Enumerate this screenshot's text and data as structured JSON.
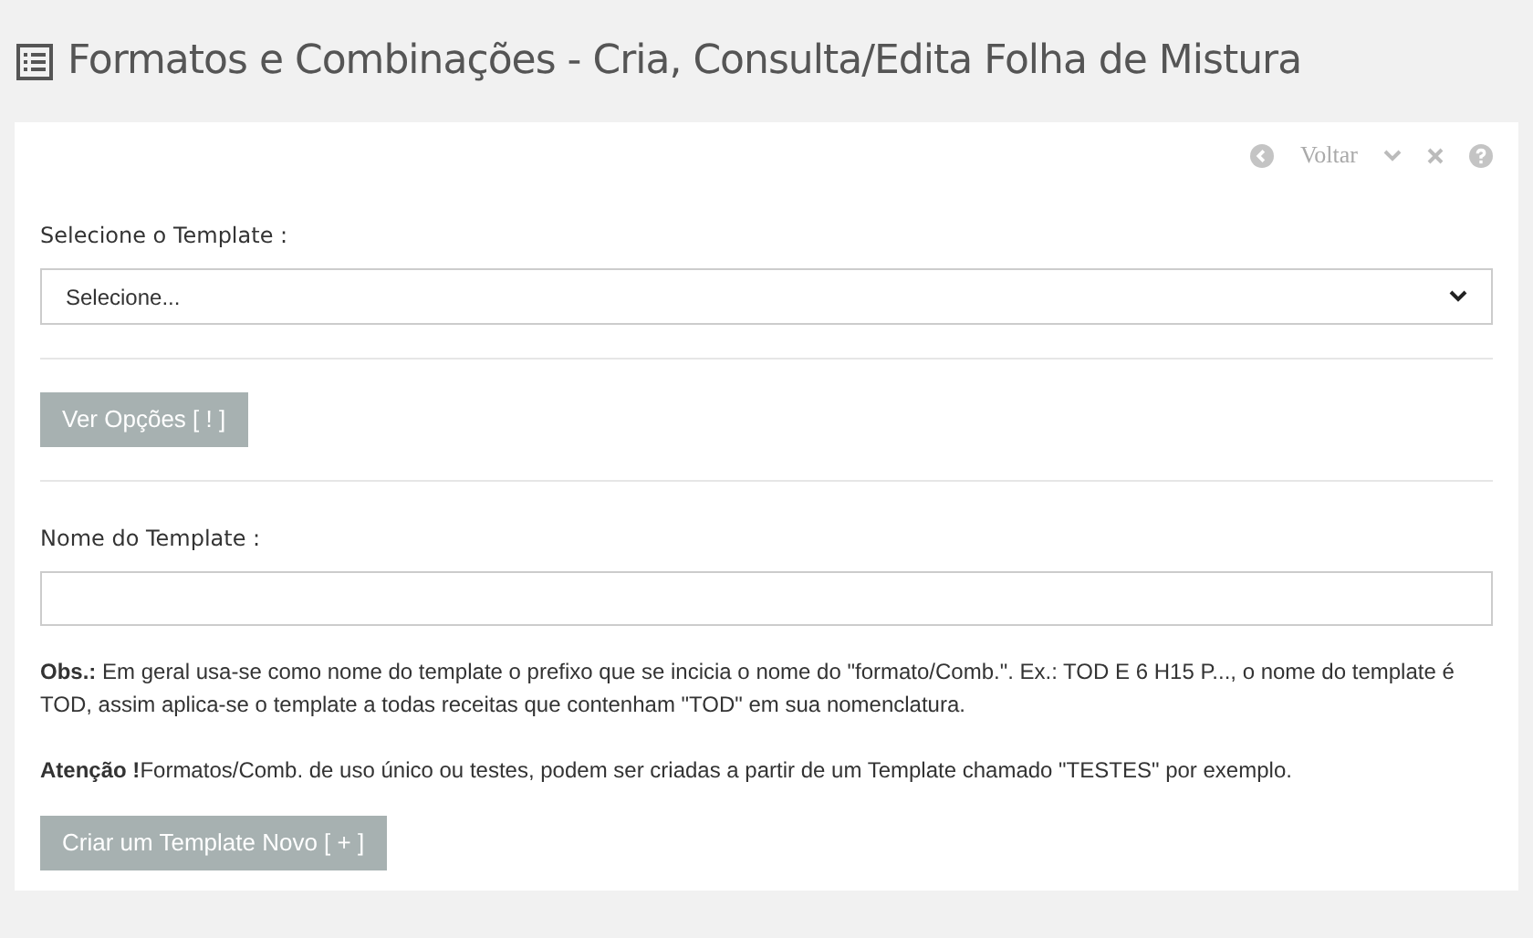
{
  "page_title": "Formatos e Combinações - Cria, Consulta/Edita Folha de Mistura",
  "toolbar": {
    "back_label": "Voltar"
  },
  "template_select": {
    "label": "Selecione o Template :",
    "value": "Selecione..."
  },
  "view_options_button": "Ver Opções [ ! ]",
  "template_name": {
    "label": "Nome do Template :"
  },
  "notes": [
    "**Obs.:** Em geral usa-se como nome do template o prefixo que se incicia o nome do \"formato/Comb.\". Ex.: TOD E 6 H15 P..., o nome do template é TOD, assim aplica-se o template a todas receitas que contenham \"TOD\" em sua nomenclatura.",
    "**Atenção !**Formatos/Comb. de uso único ou testes, podem ser criadas a partir de um Template chamado \"TESTES\" por exemplo."
  ],
  "create_button": "Criar um Template Novo [ + ]"
}
